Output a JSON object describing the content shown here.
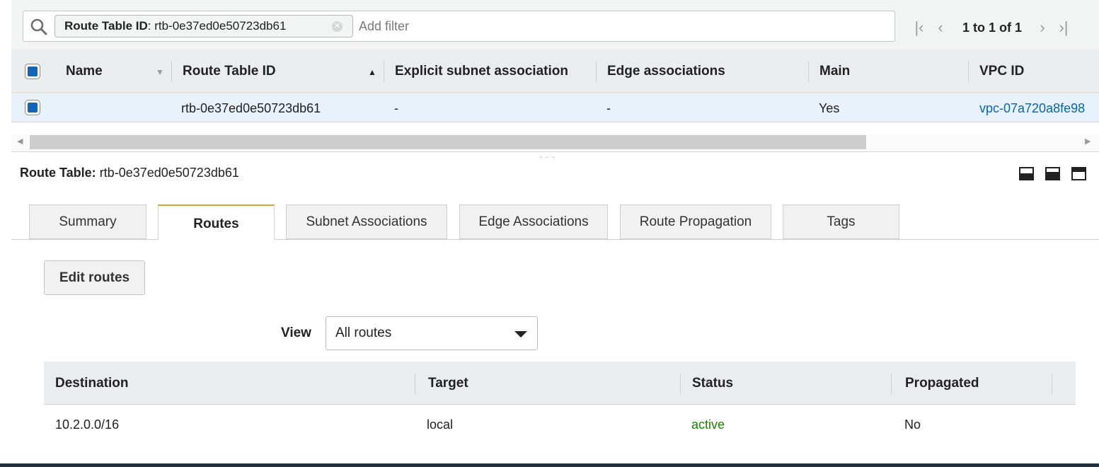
{
  "filter": {
    "chip_key": "Route Table ID",
    "chip_value": ": rtb-0e37ed0e50723db61",
    "placeholder": "Add filter"
  },
  "pager": {
    "text": "1 to 1 of 1"
  },
  "grid": {
    "columns": [
      "Name",
      "Route Table ID",
      "Explicit subnet association",
      "Edge associations",
      "Main",
      "VPC ID"
    ],
    "row": {
      "name": "",
      "route_table_id": "rtb-0e37ed0e50723db61",
      "explicit_subnet": "-",
      "edge": "-",
      "main": "Yes",
      "vpc_id": "vpc-07a720a8fe98"
    }
  },
  "detail": {
    "label": "Route Table:",
    "value": "rtb-0e37ed0e50723db61"
  },
  "tabs": [
    "Summary",
    "Routes",
    "Subnet Associations",
    "Edge Associations",
    "Route Propagation",
    "Tags"
  ],
  "active_tab": "Routes",
  "edit_button": "Edit routes",
  "view": {
    "label": "View",
    "selected": "All routes"
  },
  "routes_table": {
    "columns": [
      "Destination",
      "Target",
      "Status",
      "Propagated"
    ],
    "rows": [
      {
        "destination": "10.2.0.0/16",
        "target": "local",
        "status": "active",
        "propagated": "No"
      }
    ]
  },
  "colors": {
    "accent_tab": "#eb9e22",
    "link": "#0066c0",
    "status_active": "#1d8102",
    "checkbox": "#1166bb"
  }
}
